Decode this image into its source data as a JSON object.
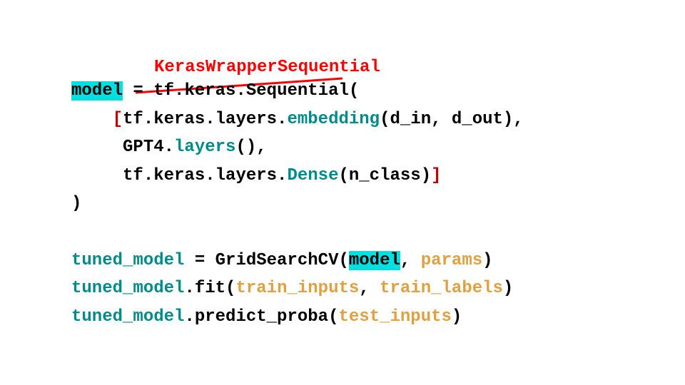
{
  "annotation": {
    "replacement": "KerasWrapperSequential"
  },
  "code": {
    "model_var": "model",
    "assign": " = ",
    "crossed_out": "tf.keras.Sequential",
    "open_paren": "(",
    "line1_pre": "    ",
    "list_open": "[",
    "line1_tf": "tf.keras.layers.",
    "line1_emb": "embedding",
    "line1_args": "(d_in, d_out),",
    "line2": "     GPT4.",
    "line2_layers": "layers",
    "line2_end": "(),",
    "line3": "     tf.keras.layers.",
    "line3_dense": "Dense",
    "line3_args": "(n_class)",
    "list_close": "]",
    "close_paren": ")",
    "blank": "",
    "tuned_model": "tuned_model",
    "gs_eq": " = GridSearchCV(",
    "model_ref": "model",
    "gs_comma": ", ",
    "params": "params",
    "gs_close": ")",
    "fit_dot": ".fit(",
    "train_inputs": "train_inputs",
    "fit_comma": ", ",
    "train_labels": "train_labels",
    "fit_close": ")",
    "pp_dot": ".predict_proba(",
    "test_inputs": "test_inputs",
    "pp_close": ")"
  }
}
